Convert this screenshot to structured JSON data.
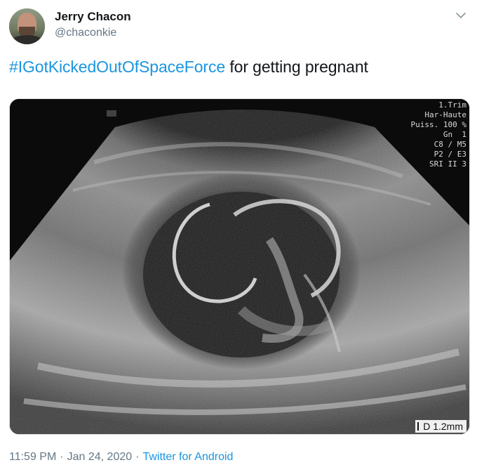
{
  "author": {
    "name": "Jerry Chacon",
    "handle": "@chaconkie"
  },
  "tweet": {
    "hashtag": "#IGotKickedOutOfSpaceForce",
    "text": " for getting pregnant"
  },
  "media": {
    "overlay_lines": [
      "1.Trim",
      "Har-Haute",
      "Puiss. 100 %",
      "Gn  1",
      "C8 / M5",
      "P2 / E3",
      "SRI II 3"
    ],
    "scale_label": "D 1.2mm"
  },
  "meta": {
    "time": "11:59 PM",
    "date": "Jan 24, 2020",
    "separator": "·",
    "source": "Twitter for Android"
  },
  "icons": {
    "menu": "chevron-down-icon"
  },
  "colors": {
    "link": "#1b95e0",
    "secondary_text": "#657786",
    "primary_text": "#14171a"
  }
}
